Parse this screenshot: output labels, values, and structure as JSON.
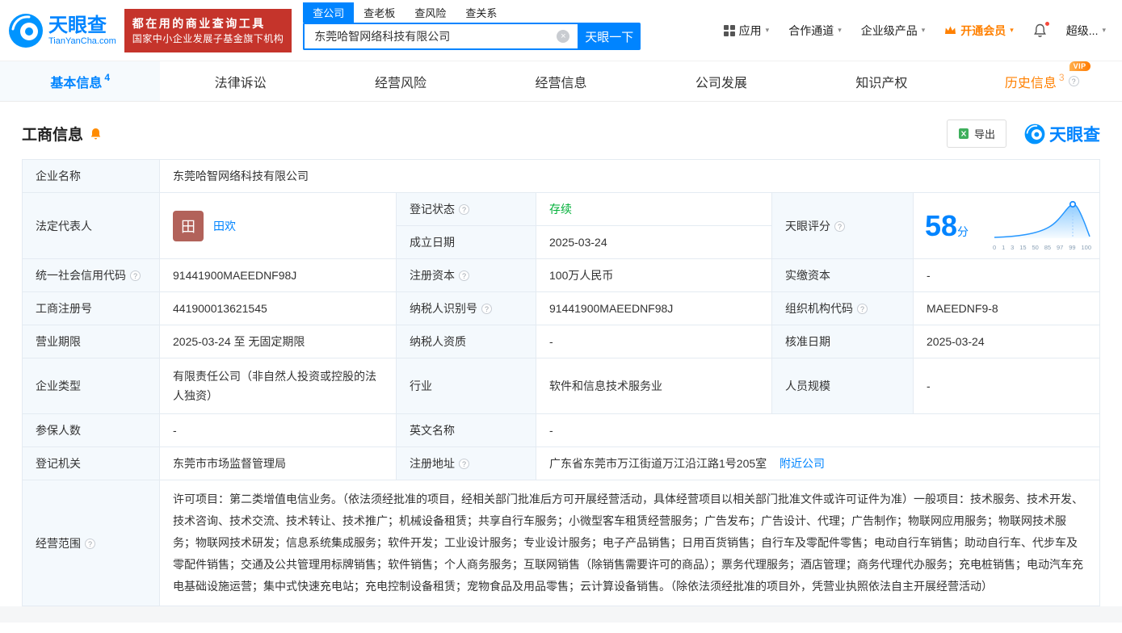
{
  "icons": {
    "help": "?",
    "caret": "▾",
    "clear": "×",
    "vip": "VIP"
  },
  "header": {
    "brand": "天眼查",
    "brand_domain": "TianYanCha.com",
    "slogan_line1": "都在用的商业查询工具",
    "slogan_line2": "国家中小企业发展子基金旗下机构",
    "search_tabs": [
      {
        "label": "查公司"
      },
      {
        "label": "查老板"
      },
      {
        "label": "查风险"
      },
      {
        "label": "查关系"
      }
    ],
    "search_value": "东莞哈智网络科技有限公司",
    "search_button": "天眼一下",
    "nav_app": "应用",
    "nav_coop": "合作通道",
    "nav_enterprise": "企业级产品",
    "nav_vip": "开通会员",
    "nav_super": "超级..."
  },
  "tabs": [
    {
      "label": "基本信息",
      "count": "4"
    },
    {
      "label": "法律诉讼"
    },
    {
      "label": "经营风险"
    },
    {
      "label": "经营信息"
    },
    {
      "label": "公司发展"
    },
    {
      "label": "知识产权"
    },
    {
      "label": "历史信息",
      "count": "3"
    }
  ],
  "section": {
    "title": "工商信息",
    "export": "导出",
    "brand": "天眼查"
  },
  "fields": {
    "company_name": {
      "label": "企业名称",
      "value": "东莞哈智网络科技有限公司"
    },
    "legal_rep": {
      "label": "法定代表人",
      "avatar": "田",
      "name": "田欢"
    },
    "reg_status": {
      "label": "登记状态",
      "value": "存续"
    },
    "est_date": {
      "label": "成立日期",
      "value": "2025-03-24"
    },
    "score": {
      "label": "天眼评分",
      "value": "58",
      "unit": "分",
      "axis": [
        "0",
        "1",
        "3",
        "15",
        "50",
        "85",
        "97",
        "99",
        "100"
      ]
    },
    "credit_code": {
      "label": "统一社会信用代码",
      "value": "91441900MAEEDNF98J"
    },
    "reg_capital": {
      "label": "注册资本",
      "value": "100万人民币"
    },
    "paid_capital": {
      "label": "实缴资本",
      "value": "-"
    },
    "reg_no": {
      "label": "工商注册号",
      "value": "441900013621545"
    },
    "taxpayer_no": {
      "label": "纳税人识别号",
      "value": "91441900MAEEDNF98J"
    },
    "org_code": {
      "label": "组织机构代码",
      "value": "MAEEDNF9-8"
    },
    "term": {
      "label": "营业期限",
      "value": "2025-03-24 至 无固定期限"
    },
    "taxpayer_qual": {
      "label": "纳税人资质",
      "value": "-"
    },
    "approval_date": {
      "label": "核准日期",
      "value": "2025-03-24"
    },
    "company_type": {
      "label": "企业类型",
      "value": "有限责任公司（非自然人投资或控股的法人独资）"
    },
    "industry": {
      "label": "行业",
      "value": "软件和信息技术服务业"
    },
    "staff_size": {
      "label": "人员规模",
      "value": "-"
    },
    "insured": {
      "label": "参保人数",
      "value": "-"
    },
    "english_name": {
      "label": "英文名称",
      "value": "-"
    },
    "authority": {
      "label": "登记机关",
      "value": "东莞市市场监督管理局"
    },
    "address": {
      "label": "注册地址",
      "value": "广东省东莞市万江街道万江沿江路1号205室",
      "link": "附近公司"
    },
    "scope": {
      "label": "经营范围",
      "value": "许可项目：第二类增值电信业务。（依法须经批准的项目，经相关部门批准后方可开展经营活动，具体经营项目以相关部门批准文件或许可证件为准）一般项目：技术服务、技术开发、技术咨询、技术交流、技术转让、技术推广；机械设备租赁；共享自行车服务；小微型客车租赁经营服务；广告发布；广告设计、代理；广告制作；物联网应用服务；物联网技术服务；物联网技术研发；信息系统集成服务；软件开发；工业设计服务；专业设计服务；电子产品销售；日用百货销售；自行车及零配件零售；电动自行车销售；助动自行车、代步车及零配件销售；交通及公共管理用标牌销售；软件销售；个人商务服务；互联网销售（除销售需要许可的商品）；票务代理服务；酒店管理；商务代理代办服务；充电桩销售；电动汽车充电基础设施运营；集中式快速充电站；充电控制设备租赁；宠物食品及用品零售；云计算设备销售。（除依法须经批准的项目外，凭营业执照依法自主开展经营活动）"
    }
  }
}
